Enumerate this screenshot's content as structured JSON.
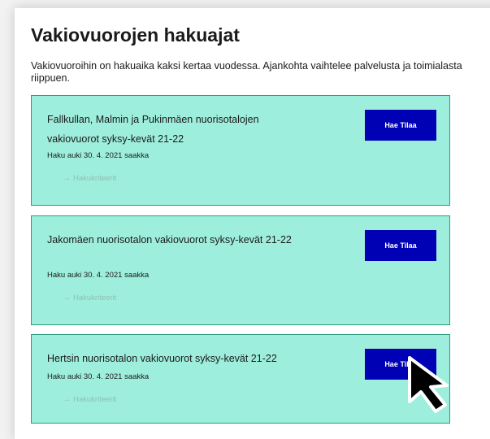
{
  "page": {
    "title": "Vakiovuorojen hakuajat",
    "intro": "Vakiovuoroihin on hakuaika kaksi kertaa vuodessa. Ajankohta vaihtelee palvelusta ja toimialasta riippuen."
  },
  "cards": [
    {
      "title": "Fallkullan, Malmin ja Pukinmäen nuorisotalojen vakiovuorot syksy-kevät 21-22",
      "deadline": "Haku auki 30. 4. 2021 saakka",
      "criteria_link": "Hakukriteerit",
      "button": "Hae Tilaa"
    },
    {
      "title": "Jakomäen nuorisotalon vakiovuorot syksy-kevät 21-22",
      "deadline": "Haku auki 30. 4. 2021 saakka",
      "criteria_link": "Hakukriteerit",
      "button": "Hae Tilaa"
    },
    {
      "title": "Hertsin nuorisotalon vakiovuorot syksy-kevät 21-22",
      "deadline": "Haku auki 30. 4. 2021 saakka",
      "criteria_link": "Hakukriteerit",
      "button": "Hae Tilaa"
    }
  ],
  "icons": {
    "link_arrow": "arrow-right-icon",
    "pointer": "mouse-cursor-icon"
  },
  "colors": {
    "card_background": "#9eeedd",
    "card_border": "#2c9c7e",
    "button": "#0000b4",
    "link": "#8fbfb3"
  }
}
